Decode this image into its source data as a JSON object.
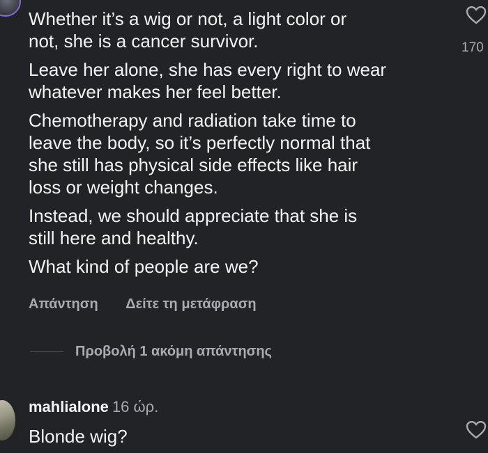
{
  "comment": {
    "paragraphs": [
      "Whether it’s a wig or not, a light color or\nnot, she is a cancer survivor.",
      "Leave her alone, she has every right to wear\nwhatever makes her feel better.",
      "Chemotherapy and radiation take time to\nleave the body, so it’s perfectly normal that\nshe still has physical side effects like hair\nloss or weight changes.",
      "Instead, we should appreciate that she is\nstill here and healthy.",
      "What kind of people are we?"
    ],
    "like_count": "170",
    "reply_label": "Απάντηση",
    "translate_label": "Δείτε τη μετάφραση",
    "view_replies_label": "Προβολή 1 ακόμη απάντησης"
  },
  "reply": {
    "username": "mahlialone",
    "time": "16 ώρ.",
    "text": "Blonde wig?"
  },
  "colors": {
    "background": "#222327",
    "text": "#f3f3f3",
    "secondary_text": "#a9abb1"
  },
  "icons": {
    "like": "heart-outline-icon"
  }
}
